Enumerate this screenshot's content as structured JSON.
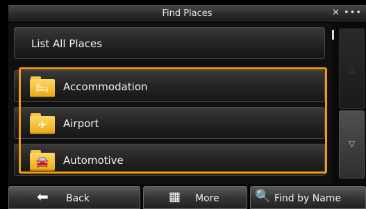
{
  "title_bar": {
    "title": "Find Places",
    "status_icons": "✕ •••"
  },
  "list": {
    "top_item": "List All Places",
    "categories": [
      {
        "label": "Accommodation",
        "icon": "bed-icon",
        "glyph": "🛏"
      },
      {
        "label": "Airport",
        "icon": "airplane-icon",
        "glyph": "✈"
      },
      {
        "label": "Automotive",
        "icon": "car-icon",
        "glyph": "🚘"
      }
    ]
  },
  "scrollbar": {
    "up_arrow": "△",
    "down_arrow": "▽"
  },
  "toolbar": {
    "back_label": "Back",
    "back_icon": "⬅",
    "more_label": "More",
    "more_icon": "▦",
    "find_label": "Find by Name",
    "find_icon": "🔍"
  },
  "colors": {
    "highlight": "#f39a12",
    "folder": "#f6c344"
  }
}
